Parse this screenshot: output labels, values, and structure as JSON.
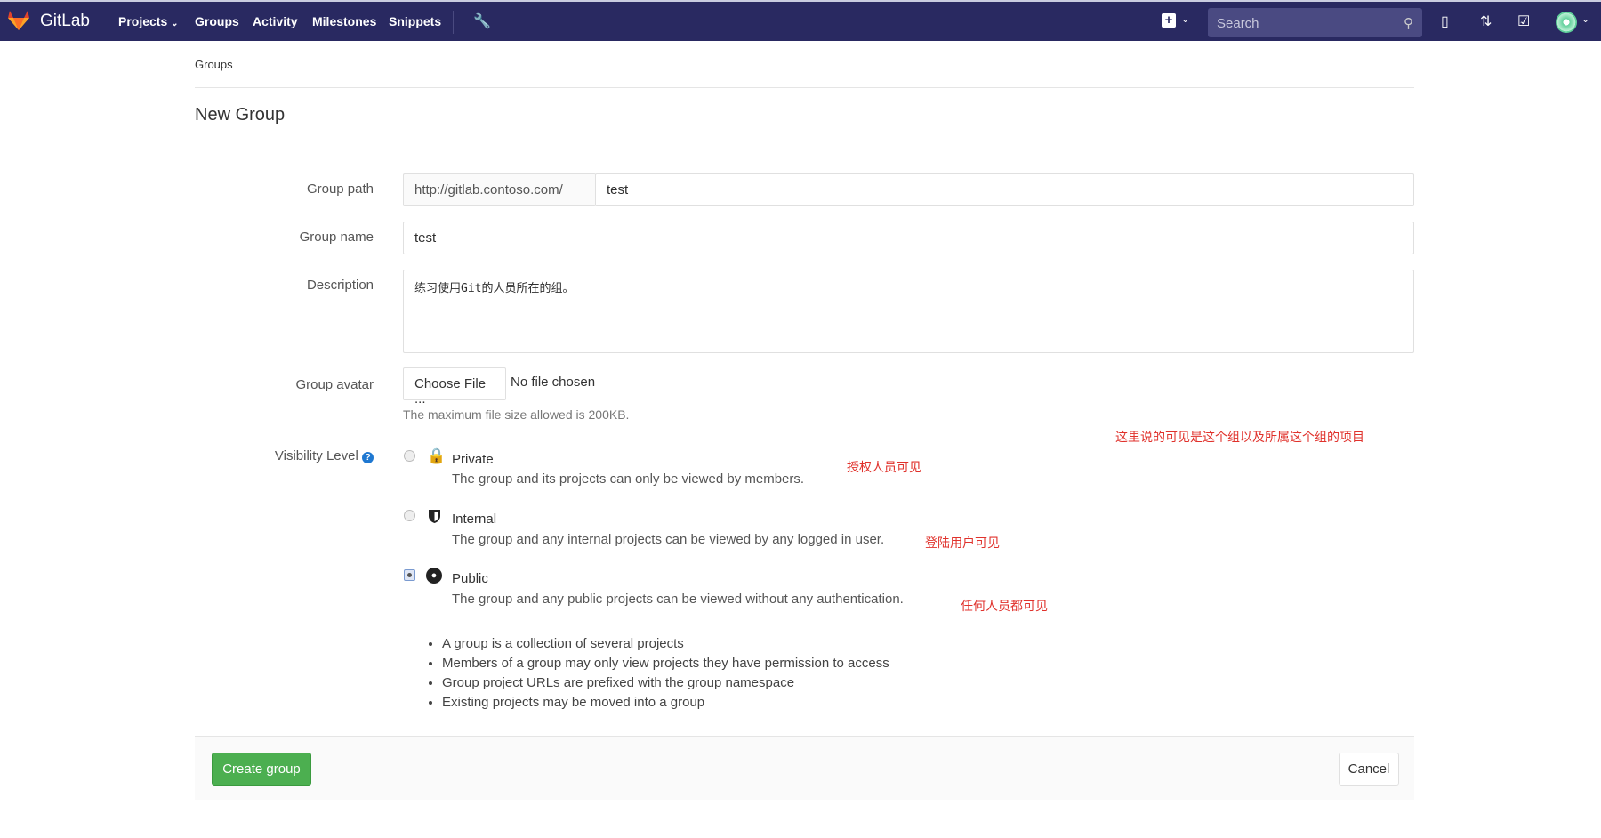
{
  "nav": {
    "brand": "GitLab",
    "items": [
      "Projects",
      "Groups",
      "Activity",
      "Milestones",
      "Snippets"
    ],
    "search_placeholder": "Search",
    "colors": {
      "bar": "#292961",
      "accent": "#4caf50",
      "annotation": "#e0322c"
    }
  },
  "breadcrumb": "Groups",
  "page_title": "New Group",
  "form": {
    "group_path": {
      "label": "Group path",
      "prefix": "http://gitlab.contoso.com/",
      "value": "test"
    },
    "group_name": {
      "label": "Group name",
      "value": "test"
    },
    "description": {
      "label": "Description",
      "value": "练习使用Git的人员所在的组。"
    },
    "avatar": {
      "label": "Group avatar",
      "button": "Choose File ...",
      "status": "No file chosen",
      "help": "The maximum file size allowed is 200KB."
    },
    "visibility": {
      "label": "Visibility Level",
      "selected": "Public",
      "options": [
        {
          "title": "Private",
          "desc": "The group and its projects can only be viewed by members.",
          "icon": "lock-icon",
          "note": "授权人员可见"
        },
        {
          "title": "Internal",
          "desc": "The group and any internal projects can be viewed by any logged in user.",
          "icon": "shield-icon",
          "note": "登陆用户可见"
        },
        {
          "title": "Public",
          "desc": "The group and any public projects can be viewed without any authentication.",
          "icon": "globe-icon",
          "note": "任何人员都可见"
        }
      ],
      "top_note": "这里说的可见是这个组以及所属这个组的项目"
    },
    "bullets": [
      "A group is a collection of several projects",
      "Members of a group may only view projects they have permission to access",
      "Group project URLs are prefixed with the group namespace",
      "Existing projects may be moved into a group"
    ]
  },
  "actions": {
    "create": "Create group",
    "cancel": "Cancel"
  }
}
